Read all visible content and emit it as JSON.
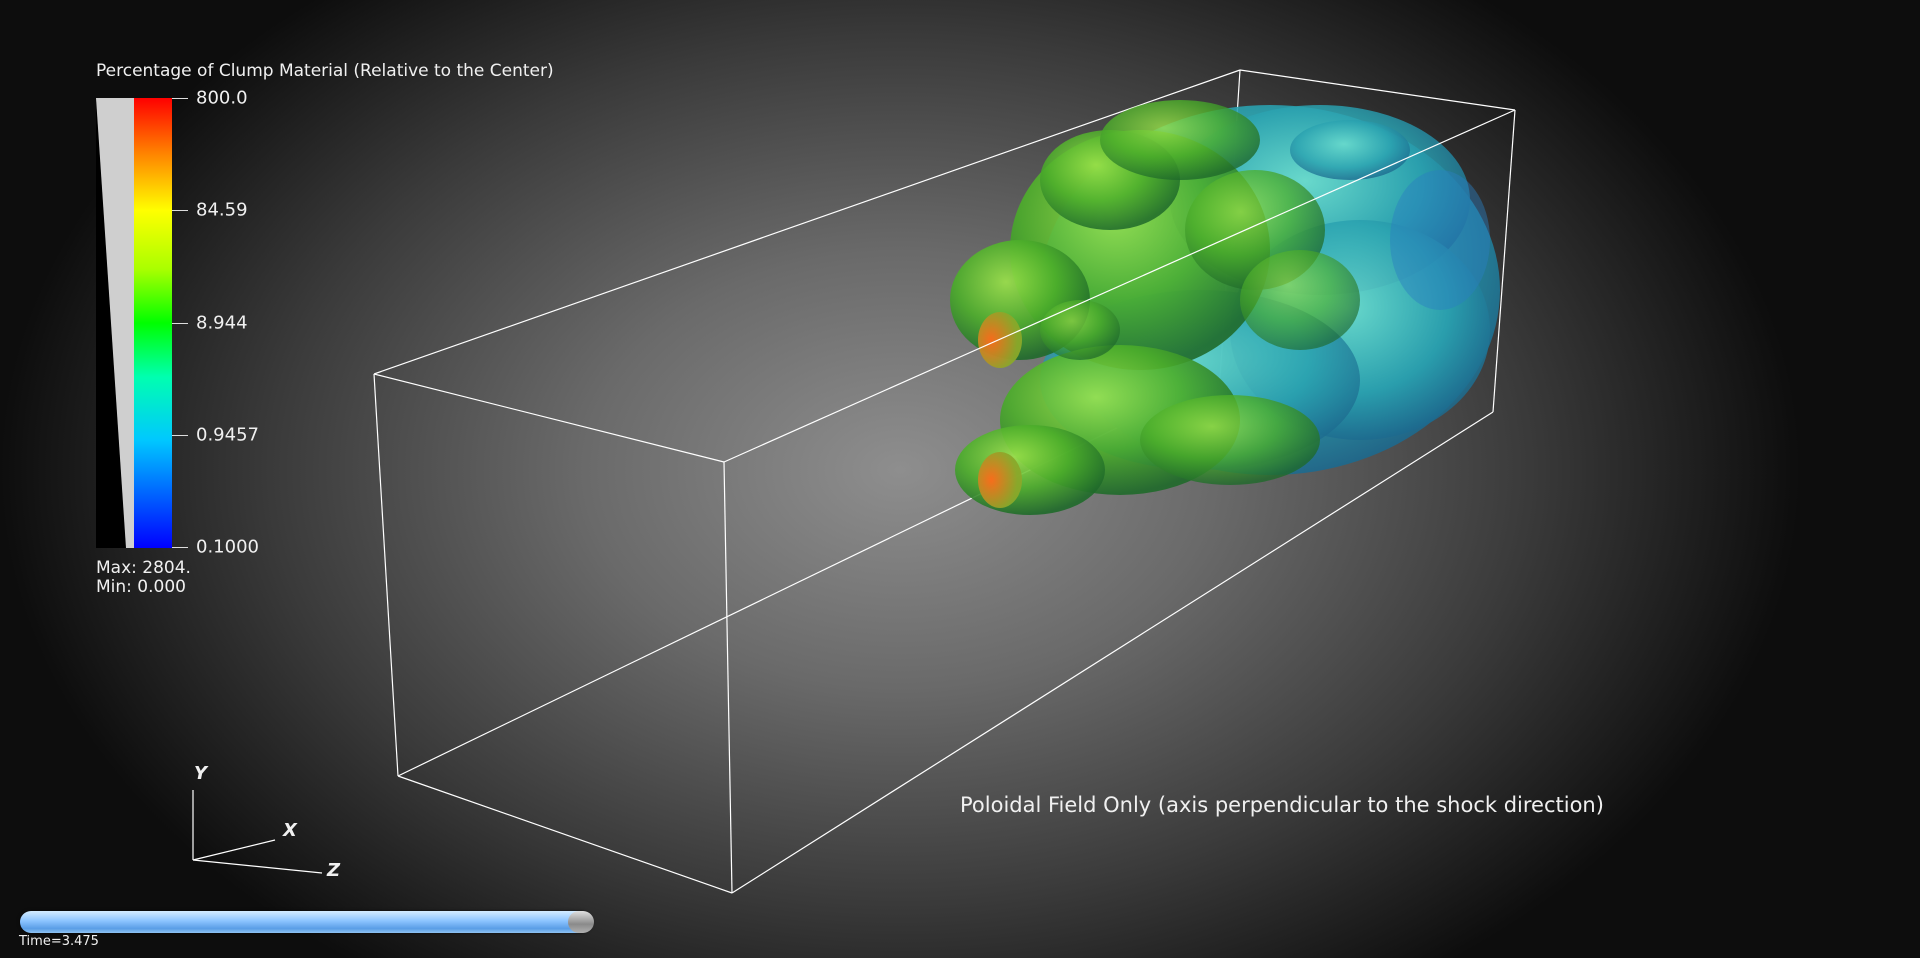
{
  "legend": {
    "title": "Percentage of Clump Material (Relative to the Center)",
    "ticks": [
      "800.0",
      "84.59",
      "8.944",
      "0.9457",
      "0.1000"
    ],
    "max_text": "Max:  2804.",
    "min_text": "Min:  0.000",
    "colormap": [
      "#0000ff",
      "#00c8ff",
      "#00ff00",
      "#ffff00",
      "#ff8000",
      "#ff0000"
    ]
  },
  "axes": {
    "y": "Y",
    "x": "X",
    "z": "Z"
  },
  "caption": "Poloidal Field Only (axis perpendicular to the shock direction)",
  "time": {
    "label": "Time=3.475",
    "progress": 0.98
  },
  "colors": {
    "wireframe": "#ffffff",
    "clump_green": "#52b82c",
    "clump_cyan": "#2aa8b4",
    "clump_tip": "#e8641c"
  }
}
